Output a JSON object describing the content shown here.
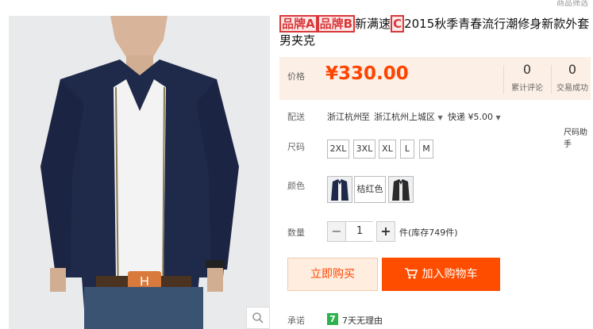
{
  "top_right_text": "商品筛选",
  "title": {
    "label_a": "品牌A",
    "label_b": "品牌B",
    "hidden_mid": "新满速",
    "label_c": "C",
    "rest": "2015秋季青春流行潮修身新款外套男夹克"
  },
  "price": {
    "label": "价格",
    "value": "¥330.00"
  },
  "stats": [
    {
      "count": "0",
      "label": "累计评论"
    },
    {
      "count": "0",
      "label": "交易成功"
    }
  ],
  "shipping": {
    "label": "配送",
    "from": "浙江杭州",
    "to_word": "至",
    "to": "浙江杭州上城区",
    "method": "快递 ¥5.00"
  },
  "size_helper": "尺码助手",
  "size": {
    "label": "尺码",
    "options": [
      "2XL",
      "3XL",
      "XL",
      "L",
      "M"
    ]
  },
  "color": {
    "label": "颜色",
    "options": [
      "",
      "桔红色",
      ""
    ]
  },
  "quantity": {
    "label": "数量",
    "value": "1",
    "minus": "−",
    "plus": "+",
    "stock": "件(库存749件)"
  },
  "buttons": {
    "buy_now": "立即购买",
    "add_cart": "加入购物车"
  },
  "promise": {
    "label": "承诺",
    "badge": "7",
    "text": "7天无理由"
  },
  "icons": [
    "search-icon",
    "caret-down-icon",
    "cart-icon",
    "seven-day-badge-icon"
  ],
  "colors": {
    "accent": "#ff4400",
    "price_bg": "#fcefe6",
    "cart_bg": "#ff4d00",
    "badge_green": "#2bb24c"
  }
}
